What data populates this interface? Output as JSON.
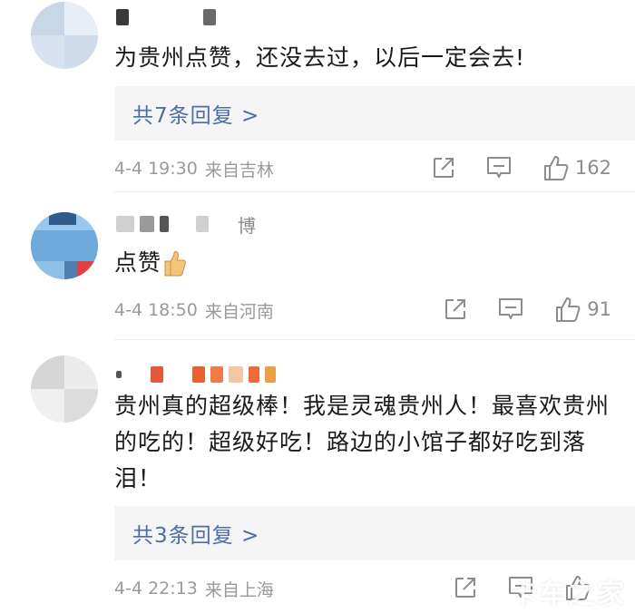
{
  "comments": [
    {
      "text": "为贵州点赞，还没去过，以后一定会去!",
      "reply_link": "共7条回复 >",
      "date": "4-4 19:30",
      "location": "来自吉林",
      "likes": "162"
    },
    {
      "name_fragment": "博",
      "text": "点赞",
      "emoji_icon": "thumbs-up-emoji",
      "date": "4-4 18:50",
      "location": "来自河南",
      "likes": "91"
    },
    {
      "text": "贵州真的超级棒！我是灵魂贵州人！最喜欢贵州的吃的！超级好吃！路边的小馆子都好吃到落泪！",
      "reply_link": "共3条回复 >",
      "date": "4-4 22:13",
      "location": "来自上海"
    }
  ],
  "icons": {
    "repost": "repost-icon",
    "comment": "comment-icon",
    "like": "like-icon"
  },
  "watermark": "卡车之家",
  "colors": {
    "reply_link": "#4a6ea8",
    "meta_text": "#9a9a9a",
    "reply_bg": "#f5f5f5"
  }
}
